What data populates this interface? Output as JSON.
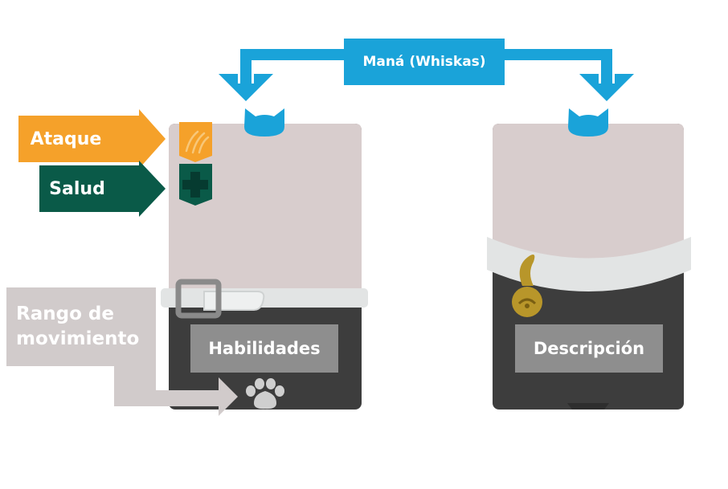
{
  "mana": {
    "label": "Maná (Whiskas)"
  },
  "stats": {
    "attack_label": "Ataque",
    "health_label": "Salud"
  },
  "movement": {
    "line1": "Rango de",
    "line2": "movimiento"
  },
  "card_front": {
    "abilities_label": "Habilidades"
  },
  "card_back": {
    "description_label": "Descripción"
  },
  "colors": {
    "mana_blue": "#1aa3d9",
    "attack_orange": "#f5a12a",
    "health_green": "#0a5a48",
    "movement_gray": "#d1cbcb",
    "card_beige": "#d8cdcd",
    "card_dark": "#3d3d3d",
    "label_box_gray": "#8e8e8e",
    "bell_gold": "#b8962a"
  }
}
